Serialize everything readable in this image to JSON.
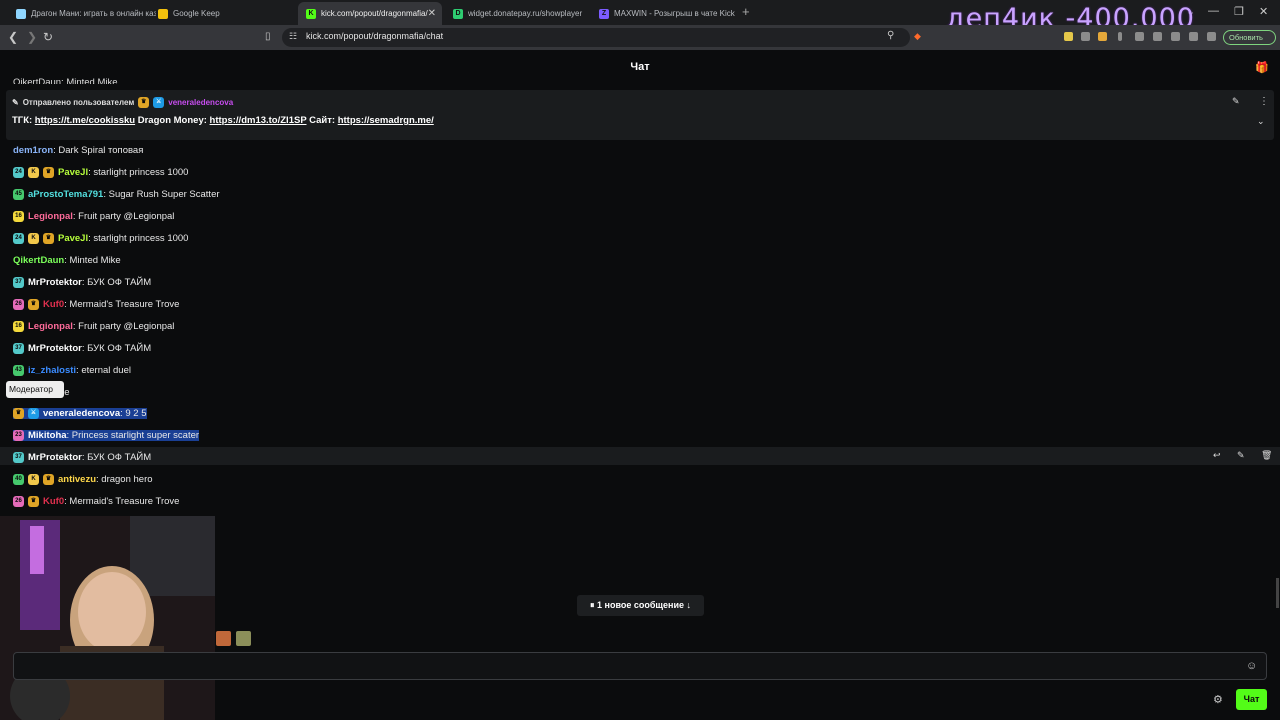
{
  "browser": {
    "tabs": [
      {
        "label": "Драгон Мани: играть в онлайн каз",
        "favicon_color": "#8fd6ff",
        "favicon_text": ""
      },
      {
        "label": "Google Keep",
        "favicon_color": "#f4c20d",
        "favicon_text": ""
      },
      {
        "label": "kick.com/popout/dragonmafia/",
        "favicon_color": "#53fc18",
        "favicon_text": "K"
      },
      {
        "label": "widget.donatepay.ru/showplayer",
        "favicon_color": "#2ecc71",
        "favicon_text": "D"
      },
      {
        "label": "MAXWIN - Розыгрыш в чате Kick",
        "favicon_color": "#7c5cff",
        "favicon_text": "Z"
      }
    ],
    "new_tab": "+",
    "url": "kick.com/popout/dragonmafia/chat",
    "update_label": "Обновить",
    "window_controls": [
      "⌄",
      "—",
      "❐",
      "✕"
    ]
  },
  "stream_overlay_text": "деп4ик -400.000",
  "chat": {
    "title": "Чат",
    "cut_line": "QikertDaun: Minted Mike",
    "pinned": {
      "by_label": "Отправлено пользователем",
      "by_user": "veneraledencova",
      "by_user_color": "#c84df0",
      "prefix_tgk": "ТГК:",
      "link_tg": "https://t.me/cookissku",
      "mid_dragon": "Dragon Money:",
      "link_dm": "https://dm13.to/ZI1SP",
      "mid_site": "Сайт:",
      "link_site": "https://semadrgn.me/"
    },
    "messages": [
      {
        "user": "dem1ron",
        "color": "#8ab4f8",
        "text": ": Dark Spiral топовая",
        "badges": []
      },
      {
        "user": "PaveJl",
        "color": "#b7ff3c",
        "text": ": starlight princess 1000",
        "badges": [
          {
            "cls": "b-sub",
            "t": "24"
          },
          {
            "cls": "b-k",
            "t": "K"
          },
          {
            "cls": "b-crown",
            "t": "♛"
          }
        ]
      },
      {
        "user": "aProstoTema791",
        "color": "#53e0e0",
        "text": ": Sugar Rush Super Scatter",
        "badges": [
          {
            "cls": "b-green",
            "t": "45"
          }
        ]
      },
      {
        "user": "Legionpal",
        "color": "#ff6b9a",
        "text": ": Fruit party @Legionpal",
        "badges": [
          {
            "cls": "b-y",
            "t": "16"
          }
        ]
      },
      {
        "user": "PaveJl",
        "color": "#b7ff3c",
        "text": ": starlight princess 1000",
        "badges": [
          {
            "cls": "b-sub",
            "t": "24"
          },
          {
            "cls": "b-k",
            "t": "K"
          },
          {
            "cls": "b-crown",
            "t": "♛"
          }
        ]
      },
      {
        "user": "QikertDaun",
        "color": "#7bff5a",
        "text": ": Minted Mike",
        "badges": []
      },
      {
        "user": "MrProtektor",
        "color": "#ffffff",
        "text": ": БУК ОФ ТАЙМ",
        "badges": [
          {
            "cls": "b-sub",
            "t": "37"
          }
        ]
      },
      {
        "user": "Kuf0",
        "color": "#e0304e",
        "text": ": Mermaid's Treasure Trove",
        "badges": [
          {
            "cls": "b-pink",
            "t": "26"
          },
          {
            "cls": "b-crown",
            "t": "♛"
          }
        ]
      },
      {
        "user": "Legionpal",
        "color": "#ff6b9a",
        "text": ": Fruit party @Legionpal",
        "badges": [
          {
            "cls": "b-y",
            "t": "16"
          }
        ]
      },
      {
        "user": "MrProtektor",
        "color": "#ffffff",
        "text": ": БУК ОФ ТАЙМ",
        "badges": [
          {
            "cls": "b-sub",
            "t": "37"
          }
        ]
      },
      {
        "user": "iz_zhalosti",
        "color": "#3b8cff",
        "text": ": eternal duel",
        "badges": [
          {
            "cls": "b-green",
            "t": "43"
          }
        ]
      },
      {
        "user": "",
        "color": "#ffffff",
        "text": ": Minted Mike",
        "badges": []
      },
      {
        "user": "veneraledencova",
        "color": "#ffffff",
        "text": ": 9 2 5",
        "badges": [
          {
            "cls": "b-crown",
            "t": "♛"
          },
          {
            "cls": "b-mod",
            "t": "⚔"
          }
        ],
        "highlight": true
      },
      {
        "user": "Mikitoha",
        "color": "#ffffff",
        "text": ": Princess starlight super scater",
        "badges": [
          {
            "cls": "b-pink",
            "t": "23"
          }
        ],
        "highlight": true
      },
      {
        "user": "MrProtektor",
        "color": "#ffffff",
        "text": ": БУК ОФ ТАЙМ",
        "badges": [
          {
            "cls": "b-sub",
            "t": "37"
          }
        ]
      },
      {
        "user": "antivezu",
        "color": "#ffd84a",
        "text": ": dragon hero",
        "badges": [
          {
            "cls": "b-green",
            "t": "40"
          },
          {
            "cls": "b-k",
            "t": "K"
          },
          {
            "cls": "b-crown",
            "t": "♛"
          }
        ]
      },
      {
        "user": "Kuf0",
        "color": "#e0304e",
        "text": ": Mermaid's Treasure Trove",
        "badges": [
          {
            "cls": "b-pink",
            "t": "26"
          },
          {
            "cls": "b-crown",
            "t": "♛"
          }
        ]
      }
    ],
    "tooltip": "Модератор",
    "new_messages": "⏸ 1 новое сообщение ↓",
    "send_label": "Чат",
    "row_actions": [
      "↩",
      "✎",
      "🗑"
    ]
  }
}
